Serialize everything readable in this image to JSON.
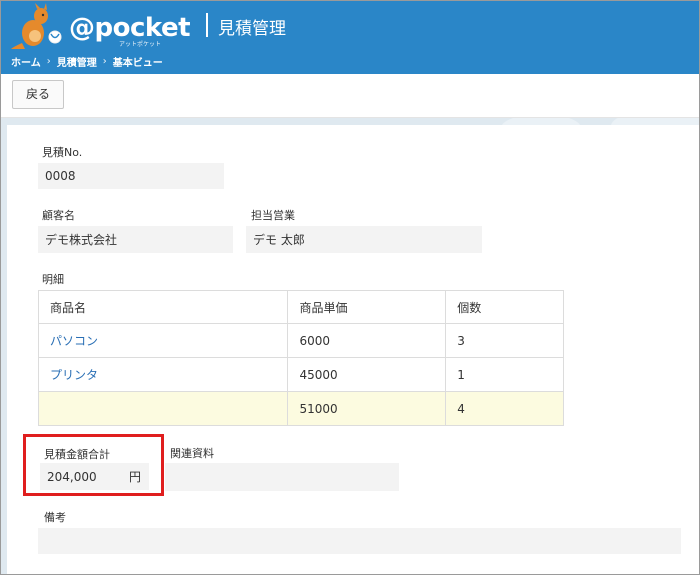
{
  "header": {
    "logo_text": "@pocket",
    "logo_sub": "アットポケット",
    "title": "見積管理"
  },
  "breadcrumb": {
    "items": [
      "ホーム",
      "見積管理",
      "基本ビュー"
    ],
    "separator": "›"
  },
  "toolbar": {
    "back_label": "戻る"
  },
  "form": {
    "estimate_no_label": "見積No.",
    "estimate_no_value": "0008",
    "customer_label": "顧客名",
    "customer_value": "デモ株式会社",
    "sales_label": "担当営業",
    "sales_value": "デモ 太郎",
    "details_label": "明細",
    "table": {
      "headers": [
        "商品名",
        "商品単価",
        "個数"
      ],
      "rows": [
        [
          "パソコン",
          "6000",
          "3"
        ],
        [
          "プリンタ",
          "45000",
          "1"
        ]
      ],
      "total_row": [
        "",
        "51000",
        "4"
      ]
    },
    "total_label": "見積金額合計",
    "total_value": "204,000",
    "total_unit": "円",
    "related_label": "関連資料",
    "related_value": "",
    "remarks_label": "備考",
    "remarks_value": ""
  },
  "colors": {
    "header_bg": "#2a86c8",
    "highlight": "#e01e1e",
    "link": "#2a6fb5",
    "total_row_bg": "#fcfbe0"
  }
}
